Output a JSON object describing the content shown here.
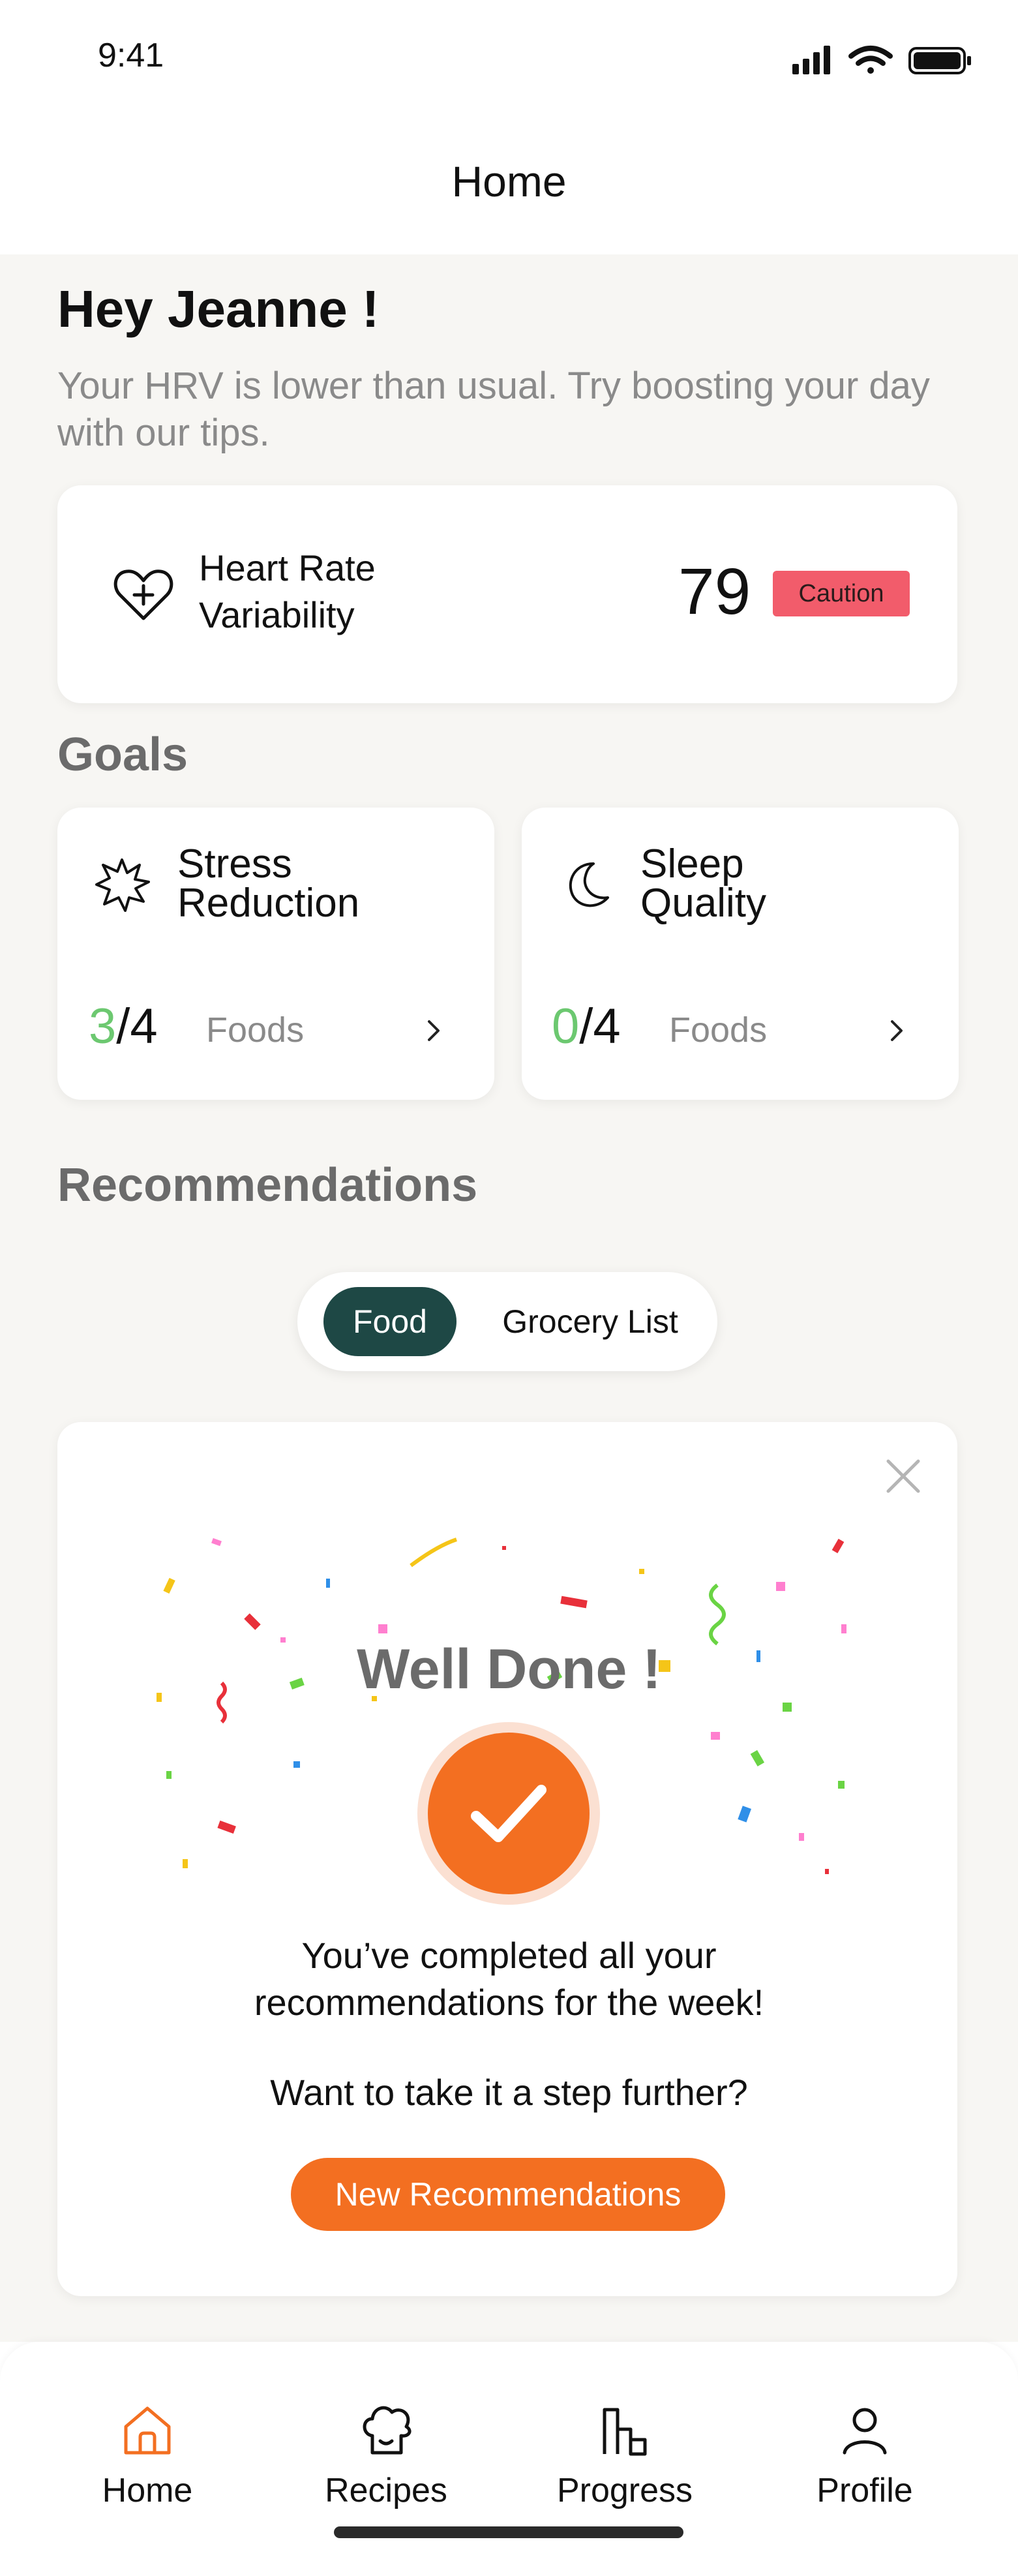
{
  "status_bar": {
    "time": "9:41"
  },
  "nav": {
    "title": "Home"
  },
  "greeting": {
    "title": "Hey Jeanne !",
    "subtitle": "Your HRV is lower than usual. Try boosting your day with our tips."
  },
  "hrv": {
    "label_line1": "Heart Rate",
    "label_line2": "Variability",
    "value": "79",
    "status": "Caution",
    "icon": "heart-plus-icon"
  },
  "goals": {
    "title": "Goals",
    "items": [
      {
        "name_line1": "Stress",
        "name_line2": "Reduction",
        "done": "3",
        "total": "/4",
        "unit": "Foods",
        "icon": "starburst-icon"
      },
      {
        "name_line1": "Sleep",
        "name_line2": "Quality",
        "done": "0",
        "total": "/4",
        "unit": "Foods",
        "icon": "moon-icon"
      }
    ]
  },
  "recommendations": {
    "title": "Recommendations",
    "tabs": [
      {
        "label": "Food",
        "active": true
      },
      {
        "label": "Grocery List",
        "active": false
      }
    ],
    "card": {
      "heading": "Well Done !",
      "message_line1": "You’ve completed all your",
      "message_line2": "recommendations for the week!",
      "prompt": "Want to take it a step further?",
      "button": "New Recommendations"
    }
  },
  "tabbar": {
    "items": [
      {
        "label": "Home",
        "icon": "home-icon",
        "active": true
      },
      {
        "label": "Recipes",
        "icon": "chef-hat-icon",
        "active": false
      },
      {
        "label": "Progress",
        "icon": "bar-chart-icon",
        "active": false
      },
      {
        "label": "Profile",
        "icon": "person-icon",
        "active": false
      }
    ]
  },
  "colors": {
    "accent_orange": "#f36f21",
    "active_green": "#1e4845",
    "progress_green": "#6cc870",
    "caution_red": "#f25c6b"
  }
}
